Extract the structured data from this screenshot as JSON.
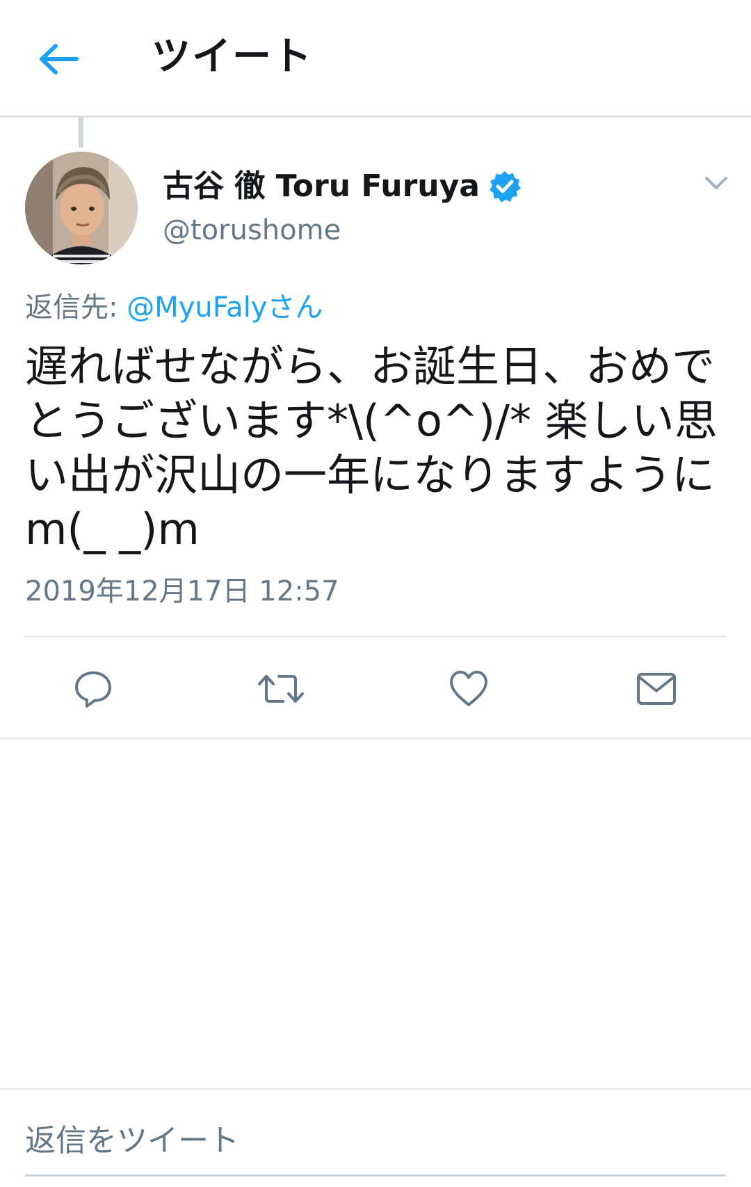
{
  "header": {
    "title": "ツイート",
    "back_icon": "arrow-left-icon"
  },
  "tweet": {
    "author_name": "古谷 徹 Toru Furuya",
    "author_handle": "@torushome",
    "verified": true,
    "reply_to_label": "返信先: ",
    "reply_to_mention": "@MyuFalyさん",
    "text": "遅ればせながら、お誕生日、おめでとうございます*\\(^o^)/* 楽しい思い出が沢山の一年になりますようにm(_ _)m",
    "timestamp": "2019年12月17日 12:57"
  },
  "actions": [
    {
      "icon": "reply-icon"
    },
    {
      "icon": "retweet-icon"
    },
    {
      "icon": "like-icon"
    },
    {
      "icon": "share-dm-icon"
    }
  ],
  "composer": {
    "placeholder": "返信をツイート"
  },
  "colors": {
    "accent": "#1da1f2",
    "secondary_text": "#657786",
    "primary_text": "#14171a",
    "divider": "#e1e8ed"
  }
}
